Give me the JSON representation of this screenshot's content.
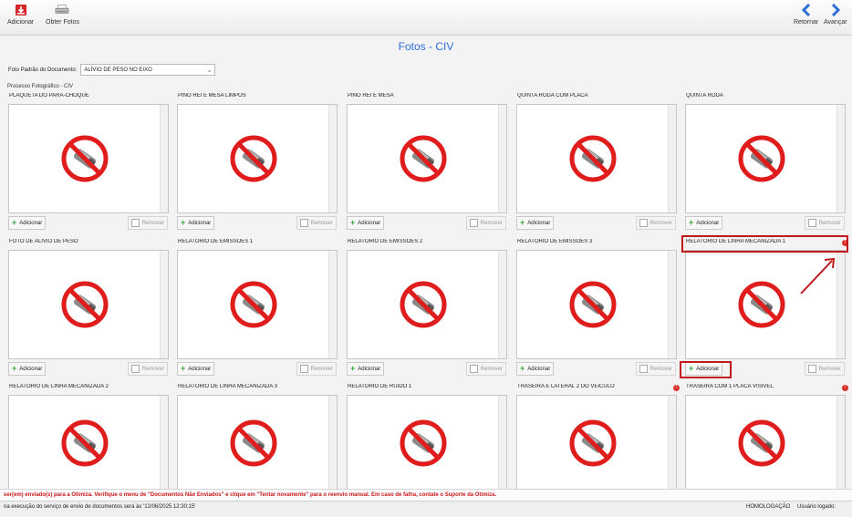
{
  "toolbar": {
    "add_label": "Adicionar",
    "get_photos_label": "Obter Fotos",
    "back_label": "Retornar",
    "forward_label": "Avançar"
  },
  "page_title": "Fotos - CIV",
  "document": {
    "label": "Foto Padrão do Documento:",
    "selected": "ALÍVIO DE PESO NO EIXO"
  },
  "process_label": "Processo Fotográfico - CIV",
  "buttons": {
    "add": "Adicionar",
    "remove": "Remover"
  },
  "tiles": [
    {
      "title": "PLAQUETA DO PARA-CHOQUE",
      "required": false
    },
    {
      "title": "PINO REI E MESA LIMPOS",
      "required": false
    },
    {
      "title": "PINO REI E MESA",
      "required": false
    },
    {
      "title": "QUINTA RODA COM PLACA",
      "required": false
    },
    {
      "title": "QUINTA RODA",
      "required": false
    },
    {
      "title": "FOTO DE ALÍVIO DE PESO",
      "required": false
    },
    {
      "title": "RELATÓRIO DE EMISSÕES 1",
      "required": false
    },
    {
      "title": "RELATÓRIO DE EMISSÕES 2",
      "required": false
    },
    {
      "title": "RELATÓRIO DE EMISSÕES 3",
      "required": false
    },
    {
      "title": "RELATÓRIO DE LINHA MECANIZADA 1",
      "required": true
    },
    {
      "title": "RELATÓRIO DE LINHA MECANIZADA 2",
      "required": false
    },
    {
      "title": "RELATÓRIO DE LINHA MECANIZADA 3",
      "required": false
    },
    {
      "title": "RELATÓRIO DE RUÍDO 1",
      "required": false
    },
    {
      "title": "TRASEIRA E LATERAL 2 DO VEÍCULO",
      "required": true
    },
    {
      "title": "TRASEIRA COM 1 PLACA VISÍVEL",
      "required": true
    }
  ],
  "status_message": "ser(em) enviado(s) para a Otimiza. Verifique o menu de \"Documentos Não Enviados\" e clique em \"Tentar novamente\" para o reenvio manual. Em caso de falha, contate o Suporte da Otimiza.",
  "statusbar": {
    "next_run": "na execução do serviço de envio de documentos será às '12/06/2025 12:30:15'",
    "mode": "HOMOLOGAÇÃO",
    "user": "Usuário logado: "
  },
  "colors": {
    "accent": "#2d6fd6",
    "highlight": "#c0191d",
    "warning": "#c9181c"
  }
}
